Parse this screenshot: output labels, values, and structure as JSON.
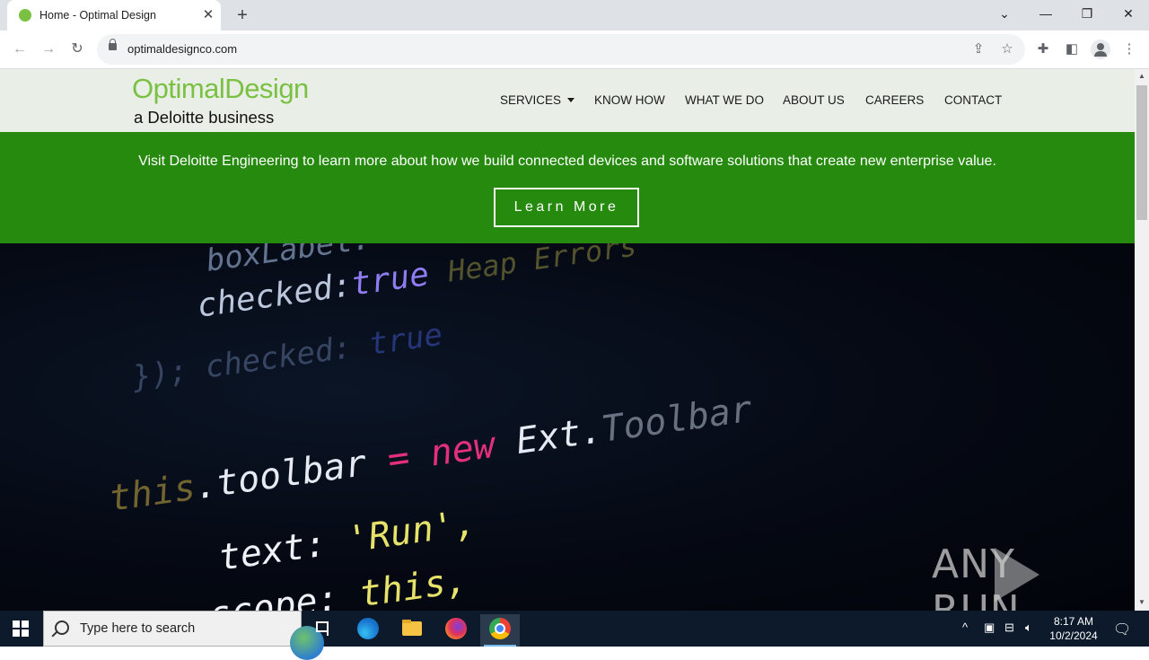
{
  "browser": {
    "tab_title": "Home - Optimal Design",
    "url": "optimaldesignco.com",
    "colors": {
      "tabstrip": "#dee1e6",
      "favicon": "#7ac143"
    }
  },
  "site": {
    "logo": {
      "main": "OptimalDesign",
      "sub": "a Deloitte business"
    },
    "nav": [
      "SERVICES",
      "KNOW HOW",
      "WHAT WE DO",
      "ABOUT US",
      "CAREERS",
      "CONTACT"
    ],
    "banner": {
      "text": "Visit Deloitte Engineering to learn more about how we build connected devices and software solutions that create new enterprise value.",
      "button": "Learn More"
    },
    "hero_code": {
      "line1": "boxLabel:",
      "line2a": "checked:",
      "line2b": "true",
      "line2c": "Heap Errors",
      "line3a": "checked:",
      "line3b": "true",
      "line3c": "});",
      "line4a": "this",
      "line4b": ".toolbar",
      "line4c": "=",
      "line4d": "new",
      "line4e": "Ext.",
      "line4f": "Toolbar",
      "line5a": "text:",
      "line5b": "'Run',",
      "line6a": "scope:",
      "line6b": "this,"
    },
    "colors": {
      "accent": "#7ac143",
      "banner": "#268a0f",
      "header_bg": "#e9efe6"
    }
  },
  "watermark": {
    "text_left": "ANY",
    "text_right": "RUN"
  },
  "taskbar": {
    "search_placeholder": "Type here to search",
    "time": "8:17 AM",
    "date": "10/2/2024"
  }
}
